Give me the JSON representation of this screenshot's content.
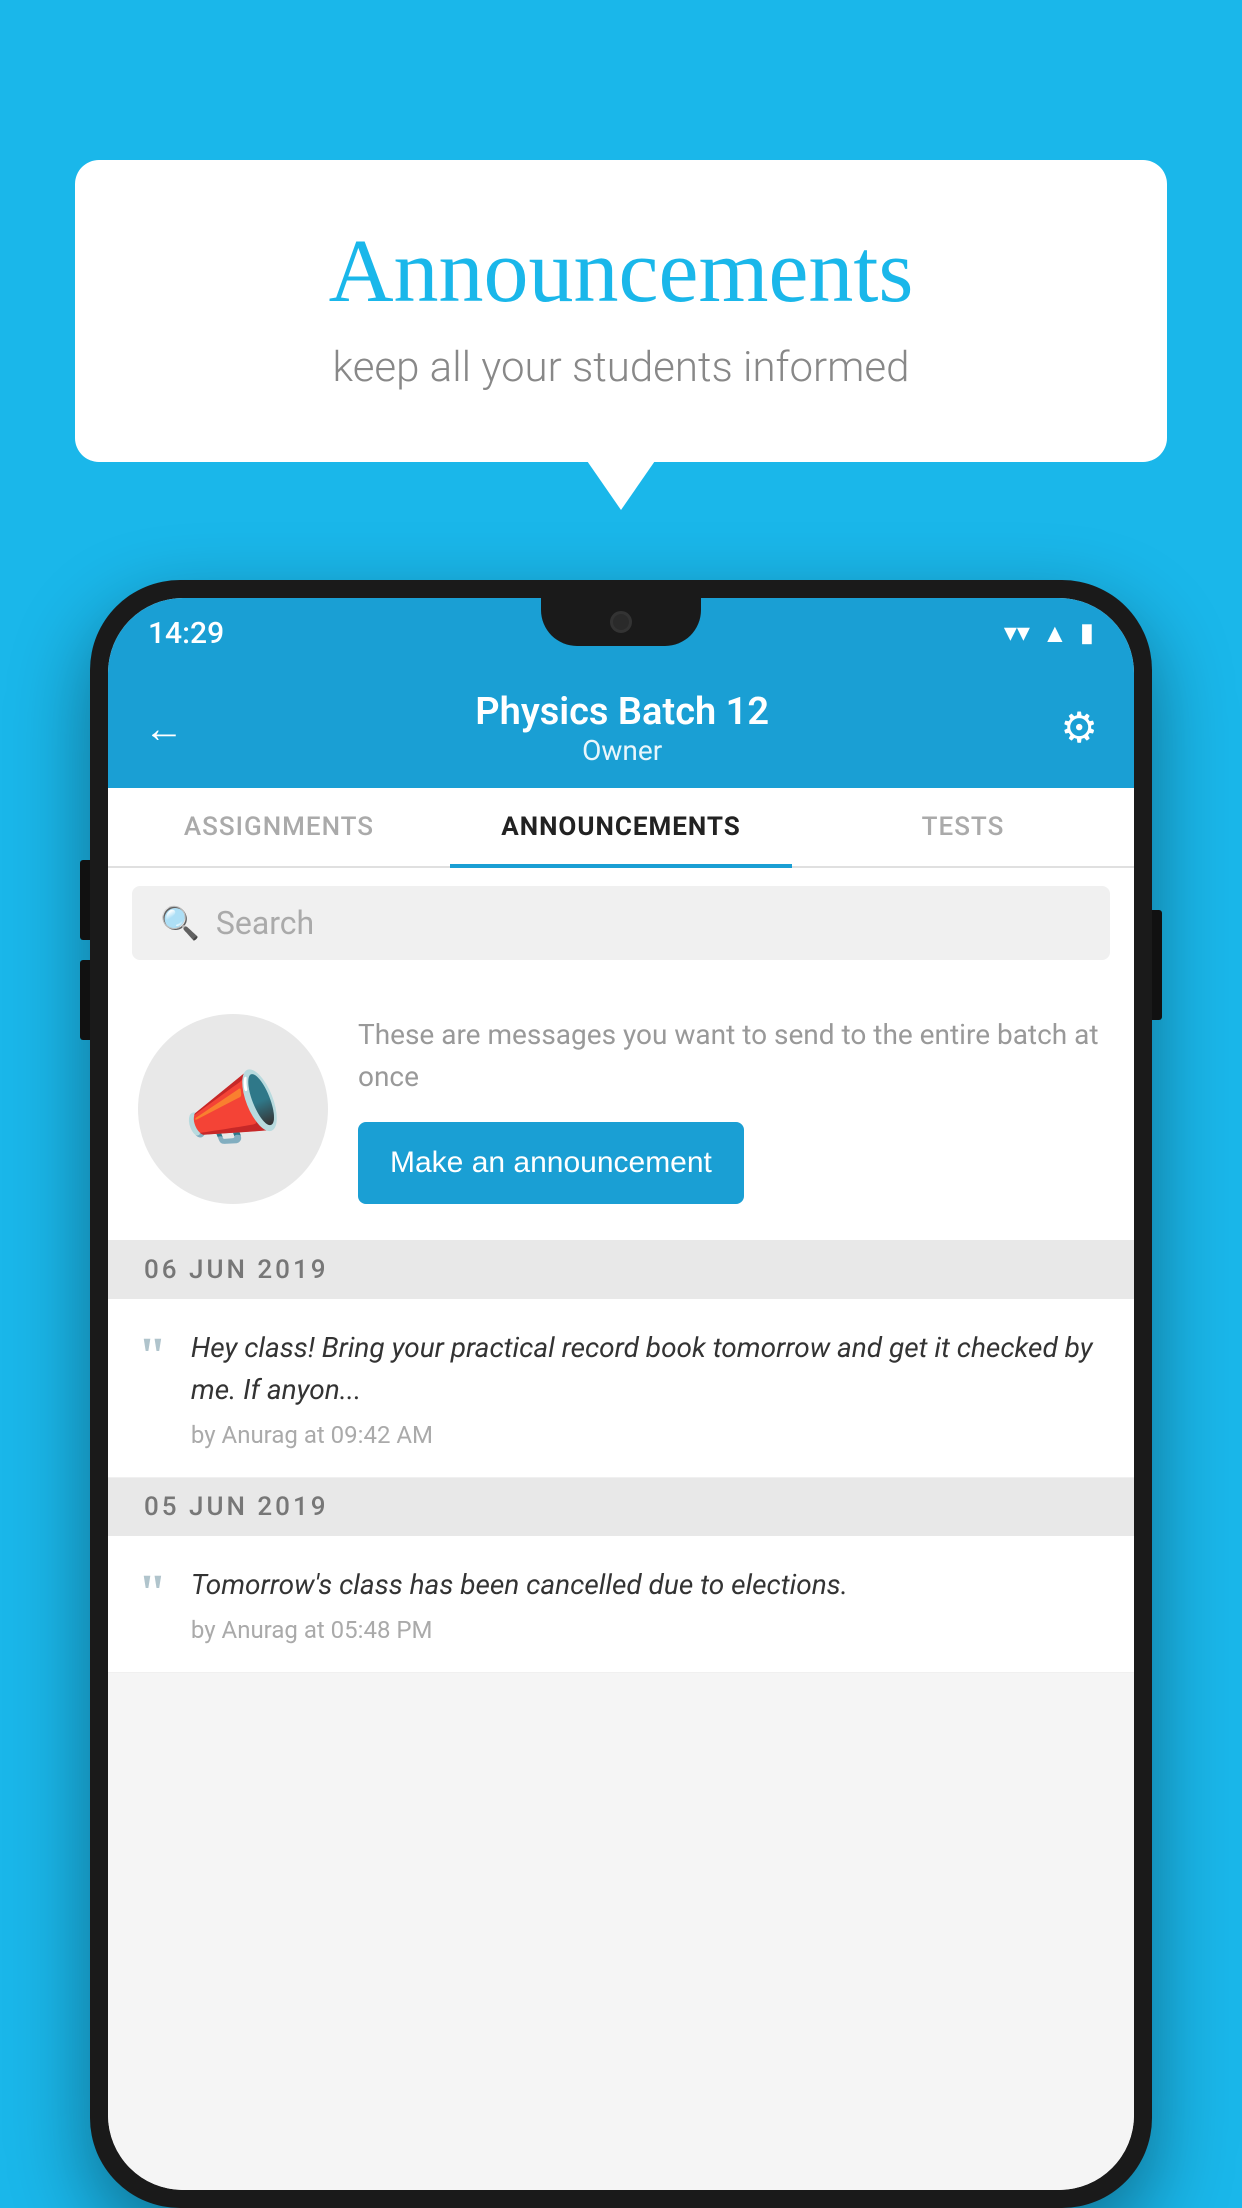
{
  "bubble": {
    "title": "Announcements",
    "subtitle": "keep all your students informed"
  },
  "statusBar": {
    "time": "14:29",
    "icons": [
      "wifi",
      "signal",
      "battery"
    ]
  },
  "appBar": {
    "title": "Physics Batch 12",
    "subtitle": "Owner",
    "backLabel": "←",
    "gearLabel": "⚙"
  },
  "tabs": [
    {
      "label": "ASSIGNMENTS",
      "active": false
    },
    {
      "label": "ANNOUNCEMENTS",
      "active": true
    },
    {
      "label": "TESTS",
      "active": false
    }
  ],
  "search": {
    "placeholder": "Search"
  },
  "announcementPrompt": {
    "descText": "These are messages you want to send to the entire batch at once",
    "buttonLabel": "Make an announcement"
  },
  "dateSections": [
    {
      "date": "06  JUN  2019",
      "items": [
        {
          "text": "Hey class! Bring your practical record book tomorrow and get it checked by me. If anyon...",
          "meta": "by Anurag at 09:42 AM"
        }
      ]
    },
    {
      "date": "05  JUN  2019",
      "items": [
        {
          "text": "Tomorrow's class has been cancelled due to elections.",
          "meta": "by Anurag at 05:48 PM"
        }
      ]
    }
  ]
}
